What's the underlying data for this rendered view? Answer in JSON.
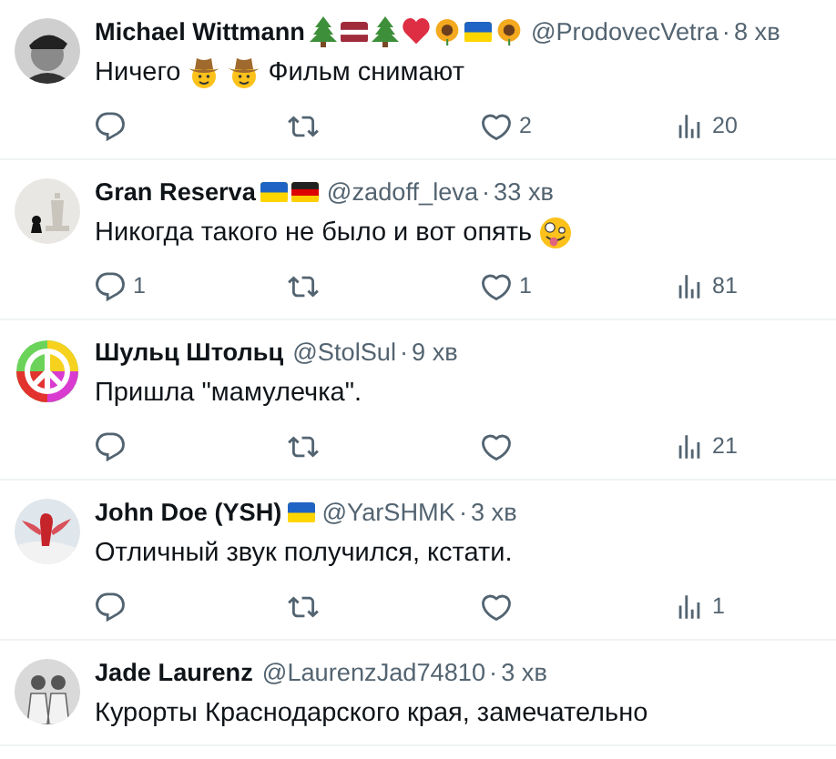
{
  "replies": [
    {
      "name": "Michael Wittmann",
      "name_badges": [
        {
          "kind": "tree"
        },
        {
          "kind": "latvia"
        },
        {
          "kind": "tree"
        },
        {
          "kind": "heart"
        },
        {
          "kind": "sunflower"
        },
        {
          "kind": "ukraine"
        },
        {
          "kind": "sunflower"
        }
      ],
      "handle": "@ProdovecVetra",
      "separator": "·",
      "time": "8 хв",
      "body": [
        {
          "kind": "text",
          "text": "Ничего"
        },
        {
          "kind": "cowboy"
        },
        {
          "kind": "cowboy"
        },
        {
          "kind": "text",
          "text": "Фильм снимают"
        }
      ],
      "like_count": "2",
      "view_count": "20"
    },
    {
      "name": "Gran Reserva",
      "name_badges": [
        {
          "kind": "ukraine"
        },
        {
          "kind": "germany"
        }
      ],
      "handle": "@zadoff_leva",
      "separator": "·",
      "time": "33 хв",
      "body": [
        {
          "kind": "text",
          "text": "Никогда такого не было и вот опять"
        },
        {
          "kind": "zany"
        }
      ],
      "reply_count": "1",
      "like_count": "1",
      "view_count": "81"
    },
    {
      "name": "Шульц Штольц",
      "handle": "@StolSul",
      "separator": "·",
      "time": "9 хв",
      "body": [
        {
          "kind": "text",
          "text": "Пришла \"мамулечка\"."
        }
      ],
      "view_count": "21"
    },
    {
      "name": "John Doe (YSH)",
      "name_badges": [
        {
          "kind": "ukraine"
        }
      ],
      "handle": "@YarSHMK",
      "separator": "·",
      "time": "3 хв",
      "body": [
        {
          "kind": "text",
          "text": "Отличный звук получился, кстати."
        }
      ],
      "view_count": "1"
    },
    {
      "name": "Jade Laurenz",
      "handle": "@LaurenzJad74810",
      "separator": "·",
      "time": "3 хв",
      "body": [
        {
          "kind": "text",
          "text": "Курорты Краснодарского края, замечательно"
        }
      ]
    }
  ]
}
